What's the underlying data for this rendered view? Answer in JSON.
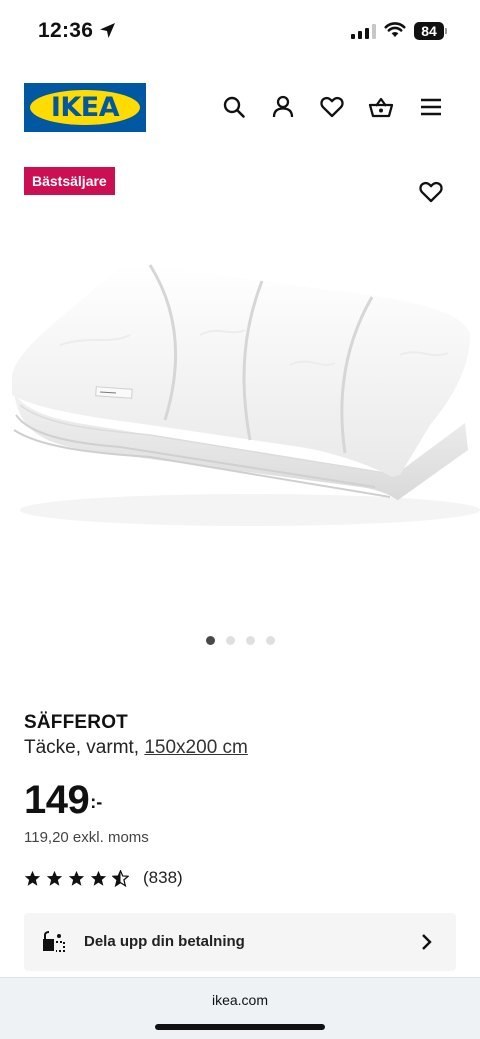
{
  "status_bar": {
    "time": "12:36",
    "battery": "84"
  },
  "header": {
    "logo_text": "IKEA",
    "icons": [
      "search-icon",
      "profile-icon",
      "heart-icon",
      "cart-icon",
      "menu-icon"
    ]
  },
  "product": {
    "badge": "Bästsäljare",
    "name": "SÄFFEROT",
    "description": "Täcke, varmt, ",
    "size": "150x200 cm",
    "price_integer": "149",
    "price_suffix": ":-",
    "price_excl_vat": "119,20 exkl. moms",
    "rating": 4.5,
    "review_count": "(838)",
    "image_count": 4,
    "active_image_index": 0
  },
  "payment": {
    "label": "Dela upp din betalning"
  },
  "browser": {
    "url": "ikea.com"
  },
  "colors": {
    "ikea_blue": "#0058a3",
    "ikea_yellow": "#ffdb00",
    "badge_red": "#cc0e52"
  }
}
